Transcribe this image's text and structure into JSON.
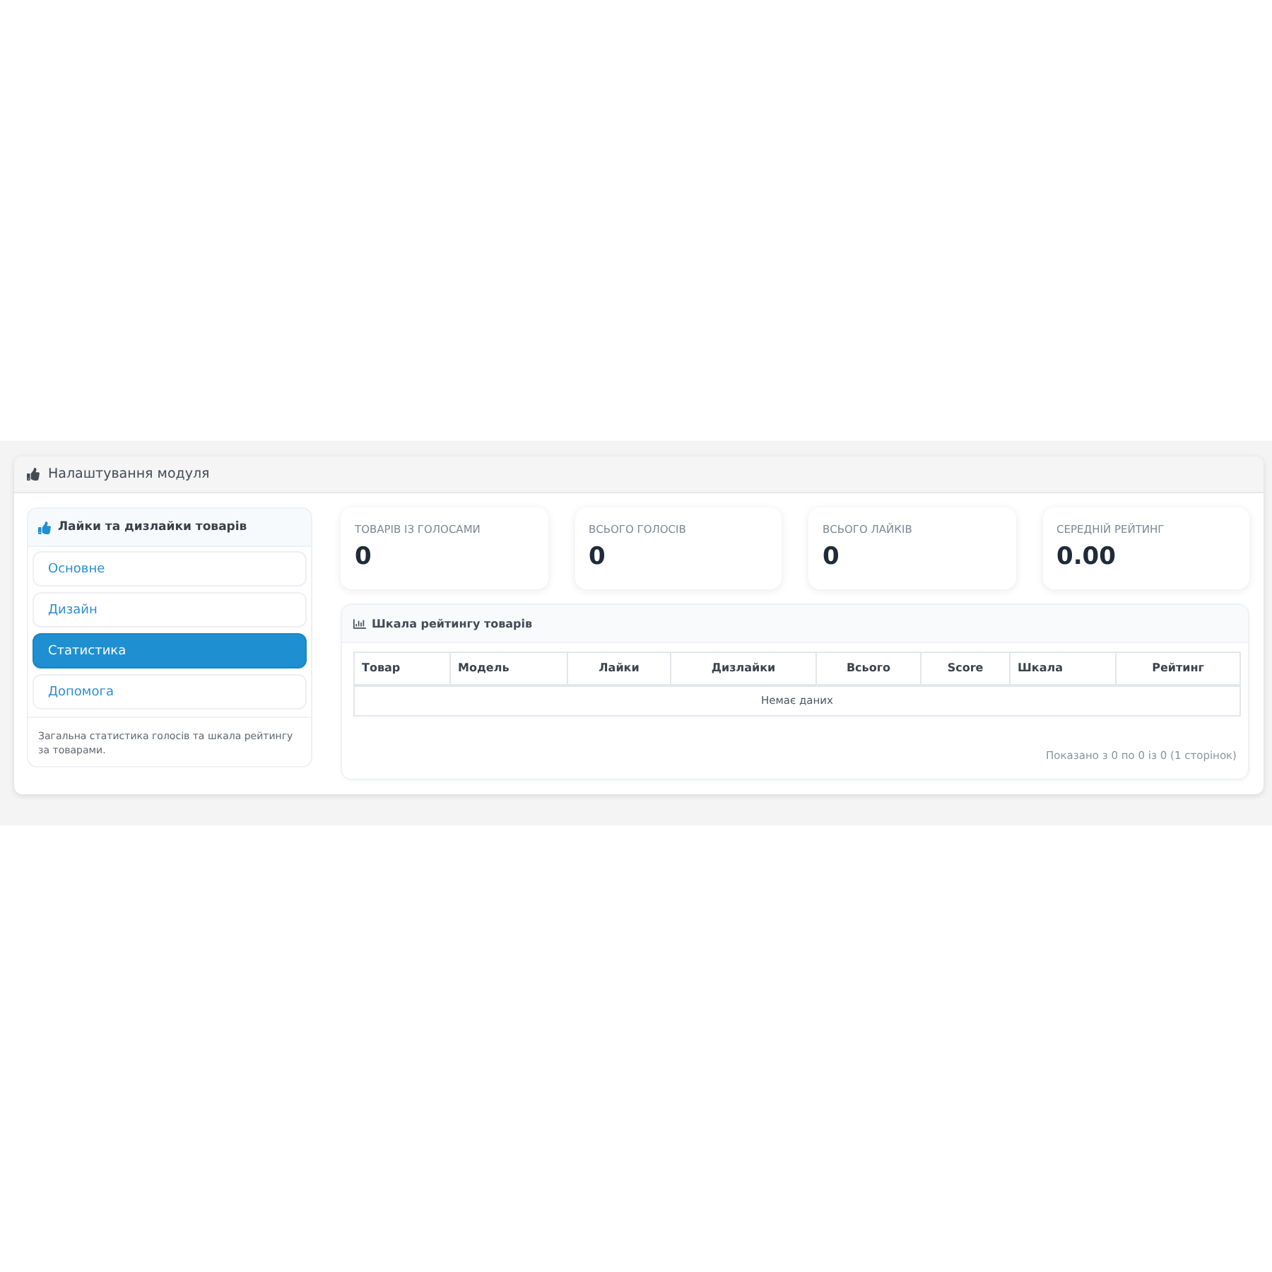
{
  "panel": {
    "title": "Налаштування модуля"
  },
  "sidebar": {
    "title": "Лайки та дизлайки товарів",
    "items": [
      {
        "label": "Основне",
        "selected": false
      },
      {
        "label": "Дизайн",
        "selected": false
      },
      {
        "label": "Статистика",
        "selected": true
      },
      {
        "label": "Допомога",
        "selected": false
      }
    ],
    "description": "Загальна статистика голосів та шкала рейтингу за товарами."
  },
  "stats": [
    {
      "label": "ТОВАРІВ ІЗ ГОЛОСАМИ",
      "value": "0"
    },
    {
      "label": "ВСЬОГО ГОЛОСІВ",
      "value": "0"
    },
    {
      "label": "ВСЬОГО ЛАЙКІВ",
      "value": "0"
    },
    {
      "label": "СЕРЕДНІЙ РЕЙТИНГ",
      "value": "0.00"
    }
  ],
  "rating_table": {
    "title": "Шкала рейтингу товарів",
    "columns": [
      "Товар",
      "Модель",
      "Лайки",
      "Дизлайки",
      "Всього",
      "Score",
      "Шкала",
      "Рейтинг"
    ],
    "empty_message": "Немає даних",
    "pagination": "Показано з 0 по 0 із 0 (1 сторінок)"
  }
}
